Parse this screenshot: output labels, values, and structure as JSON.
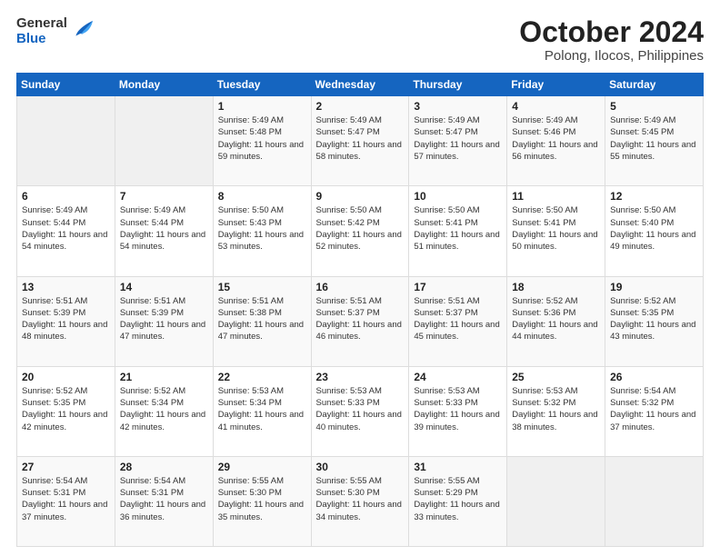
{
  "header": {
    "logo_general": "General",
    "logo_blue": "Blue",
    "month_title": "October 2024",
    "subtitle": "Polong, Ilocos, Philippines"
  },
  "weekdays": [
    "Sunday",
    "Monday",
    "Tuesday",
    "Wednesday",
    "Thursday",
    "Friday",
    "Saturday"
  ],
  "weeks": [
    [
      {
        "day": "",
        "info": ""
      },
      {
        "day": "",
        "info": ""
      },
      {
        "day": "1",
        "sunrise": "5:49 AM",
        "sunset": "5:48 PM",
        "daylight": "11 hours and 59 minutes."
      },
      {
        "day": "2",
        "sunrise": "5:49 AM",
        "sunset": "5:47 PM",
        "daylight": "11 hours and 58 minutes."
      },
      {
        "day": "3",
        "sunrise": "5:49 AM",
        "sunset": "5:47 PM",
        "daylight": "11 hours and 57 minutes."
      },
      {
        "day": "4",
        "sunrise": "5:49 AM",
        "sunset": "5:46 PM",
        "daylight": "11 hours and 56 minutes."
      },
      {
        "day": "5",
        "sunrise": "5:49 AM",
        "sunset": "5:45 PM",
        "daylight": "11 hours and 55 minutes."
      }
    ],
    [
      {
        "day": "6",
        "sunrise": "5:49 AM",
        "sunset": "5:44 PM",
        "daylight": "11 hours and 54 minutes."
      },
      {
        "day": "7",
        "sunrise": "5:49 AM",
        "sunset": "5:44 PM",
        "daylight": "11 hours and 54 minutes."
      },
      {
        "day": "8",
        "sunrise": "5:50 AM",
        "sunset": "5:43 PM",
        "daylight": "11 hours and 53 minutes."
      },
      {
        "day": "9",
        "sunrise": "5:50 AM",
        "sunset": "5:42 PM",
        "daylight": "11 hours and 52 minutes."
      },
      {
        "day": "10",
        "sunrise": "5:50 AM",
        "sunset": "5:41 PM",
        "daylight": "11 hours and 51 minutes."
      },
      {
        "day": "11",
        "sunrise": "5:50 AM",
        "sunset": "5:41 PM",
        "daylight": "11 hours and 50 minutes."
      },
      {
        "day": "12",
        "sunrise": "5:50 AM",
        "sunset": "5:40 PM",
        "daylight": "11 hours and 49 minutes."
      }
    ],
    [
      {
        "day": "13",
        "sunrise": "5:51 AM",
        "sunset": "5:39 PM",
        "daylight": "11 hours and 48 minutes."
      },
      {
        "day": "14",
        "sunrise": "5:51 AM",
        "sunset": "5:39 PM",
        "daylight": "11 hours and 47 minutes."
      },
      {
        "day": "15",
        "sunrise": "5:51 AM",
        "sunset": "5:38 PM",
        "daylight": "11 hours and 47 minutes."
      },
      {
        "day": "16",
        "sunrise": "5:51 AM",
        "sunset": "5:37 PM",
        "daylight": "11 hours and 46 minutes."
      },
      {
        "day": "17",
        "sunrise": "5:51 AM",
        "sunset": "5:37 PM",
        "daylight": "11 hours and 45 minutes."
      },
      {
        "day": "18",
        "sunrise": "5:52 AM",
        "sunset": "5:36 PM",
        "daylight": "11 hours and 44 minutes."
      },
      {
        "day": "19",
        "sunrise": "5:52 AM",
        "sunset": "5:35 PM",
        "daylight": "11 hours and 43 minutes."
      }
    ],
    [
      {
        "day": "20",
        "sunrise": "5:52 AM",
        "sunset": "5:35 PM",
        "daylight": "11 hours and 42 minutes."
      },
      {
        "day": "21",
        "sunrise": "5:52 AM",
        "sunset": "5:34 PM",
        "daylight": "11 hours and 42 minutes."
      },
      {
        "day": "22",
        "sunrise": "5:53 AM",
        "sunset": "5:34 PM",
        "daylight": "11 hours and 41 minutes."
      },
      {
        "day": "23",
        "sunrise": "5:53 AM",
        "sunset": "5:33 PM",
        "daylight": "11 hours and 40 minutes."
      },
      {
        "day": "24",
        "sunrise": "5:53 AM",
        "sunset": "5:33 PM",
        "daylight": "11 hours and 39 minutes."
      },
      {
        "day": "25",
        "sunrise": "5:53 AM",
        "sunset": "5:32 PM",
        "daylight": "11 hours and 38 minutes."
      },
      {
        "day": "26",
        "sunrise": "5:54 AM",
        "sunset": "5:32 PM",
        "daylight": "11 hours and 37 minutes."
      }
    ],
    [
      {
        "day": "27",
        "sunrise": "5:54 AM",
        "sunset": "5:31 PM",
        "daylight": "11 hours and 37 minutes."
      },
      {
        "day": "28",
        "sunrise": "5:54 AM",
        "sunset": "5:31 PM",
        "daylight": "11 hours and 36 minutes."
      },
      {
        "day": "29",
        "sunrise": "5:55 AM",
        "sunset": "5:30 PM",
        "daylight": "11 hours and 35 minutes."
      },
      {
        "day": "30",
        "sunrise": "5:55 AM",
        "sunset": "5:30 PM",
        "daylight": "11 hours and 34 minutes."
      },
      {
        "day": "31",
        "sunrise": "5:55 AM",
        "sunset": "5:29 PM",
        "daylight": "11 hours and 33 minutes."
      },
      {
        "day": "",
        "info": ""
      },
      {
        "day": "",
        "info": ""
      }
    ]
  ]
}
